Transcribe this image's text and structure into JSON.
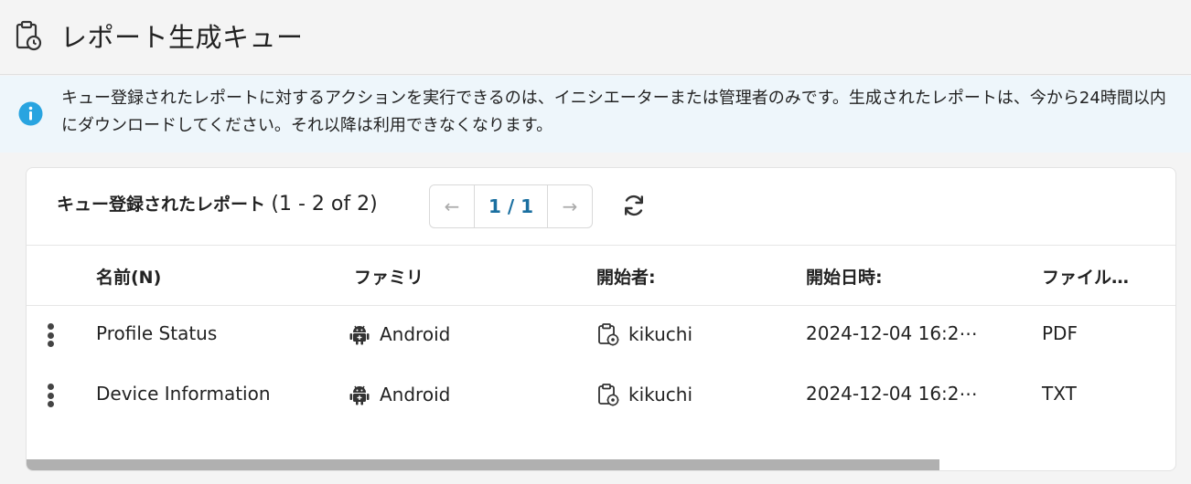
{
  "header": {
    "title": "レポート生成キュー",
    "icon": "clipboard-clock-icon"
  },
  "banner": {
    "icon": "info-icon",
    "text": "キュー登録されたレポートに対するアクションを実行できるのは、イニシエーターまたは管理者のみです。生成されたレポートは、今から24時間以内にダウンロードしてください。それ以降は利用できなくなります。"
  },
  "panel": {
    "title_bold": "キュー登録されたレポート",
    "title_count": "(1 - 2 of 2)",
    "pager": {
      "prev": "←",
      "page": "1 / 1",
      "next": "→"
    },
    "refresh_icon": "refresh-icon"
  },
  "table": {
    "columns": [
      "名前(N)",
      "ファミリ",
      "開始者:",
      "開始日時:",
      "ファイル…"
    ],
    "rows": [
      {
        "name": "Profile Status",
        "family": "Android",
        "initiator": "kikuchi",
        "started": "2024-12-04 16:2⋯",
        "file": "PDF"
      },
      {
        "name": "Device Information",
        "family": "Android",
        "initiator": "kikuchi",
        "started": "2024-12-04 16:2⋯",
        "file": "TXT"
      }
    ]
  },
  "colors": {
    "banner_bg": "#eef6fb",
    "info_blue": "#29a4e0",
    "page_link": "#1a6fa0"
  }
}
